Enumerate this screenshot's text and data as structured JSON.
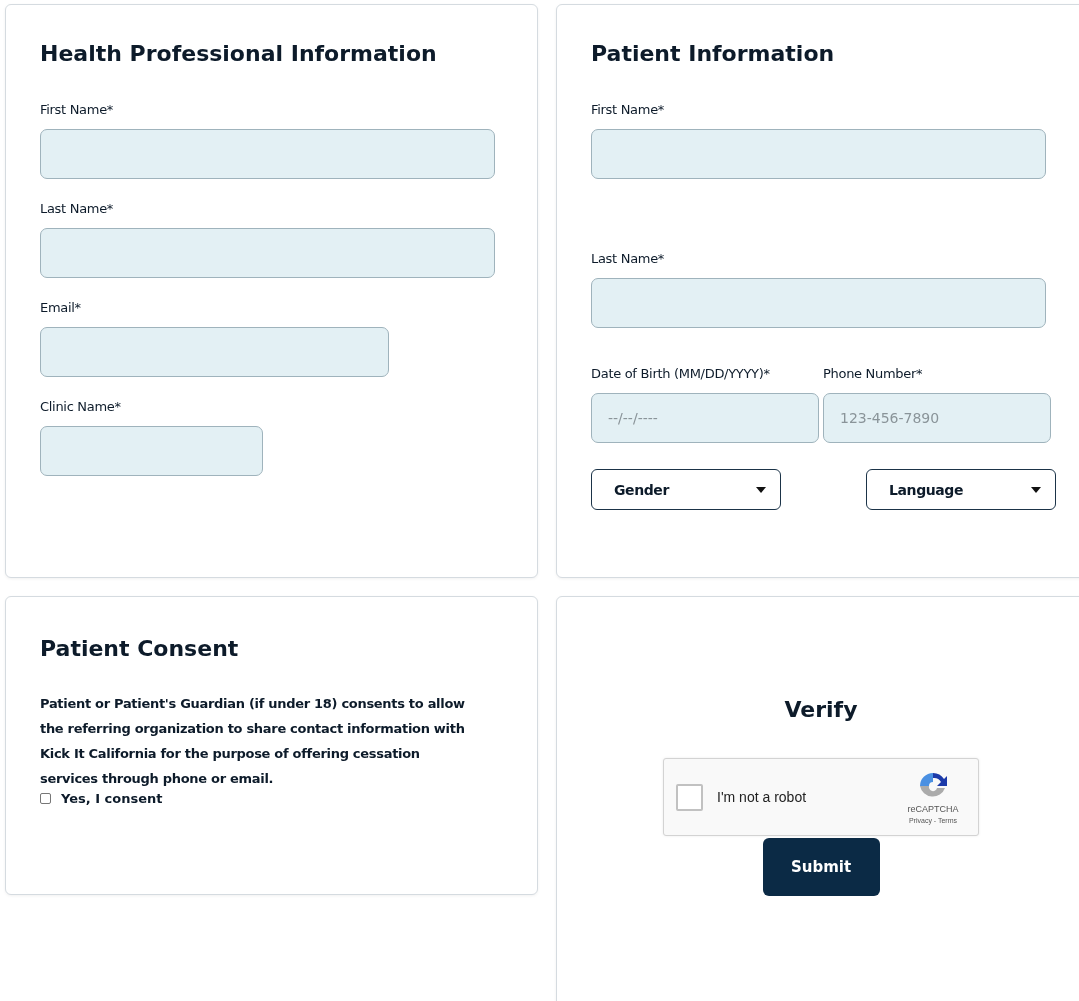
{
  "health_professional": {
    "title": "Health Professional Information",
    "fields": [
      {
        "label": "First Name*"
      },
      {
        "label": "Last Name*"
      },
      {
        "label": "Email*"
      },
      {
        "label": "Clinic Name*"
      }
    ]
  },
  "patient": {
    "title": "Patient Information",
    "fields": [
      {
        "label": "First Name*"
      },
      {
        "label": "Last Name*"
      },
      {
        "label": "Date of Birth (MM/DD/YYYY)*",
        "placeholder": "--/--/----"
      },
      {
        "label": "Phone Number*",
        "placeholder": "123-456-7890"
      }
    ],
    "selects": [
      {
        "label": "Gender"
      },
      {
        "label": "Language"
      }
    ]
  },
  "consent": {
    "title": "Patient Consent",
    "text": "Patient or Patient's Guardian (if under 18) consents to allow the referring organization to share contact information with Kick It California for the purpose of offering cessation services through phone or email.",
    "checkbox": {
      "label": "Yes, I consent",
      "checked": false
    }
  },
  "verify": {
    "title": "Verify",
    "captcha": {
      "label": "I'm not a robot",
      "checked": false,
      "brand": "reCAPTCHA",
      "links": "Privacy - Terms"
    },
    "submit": "Submit"
  }
}
